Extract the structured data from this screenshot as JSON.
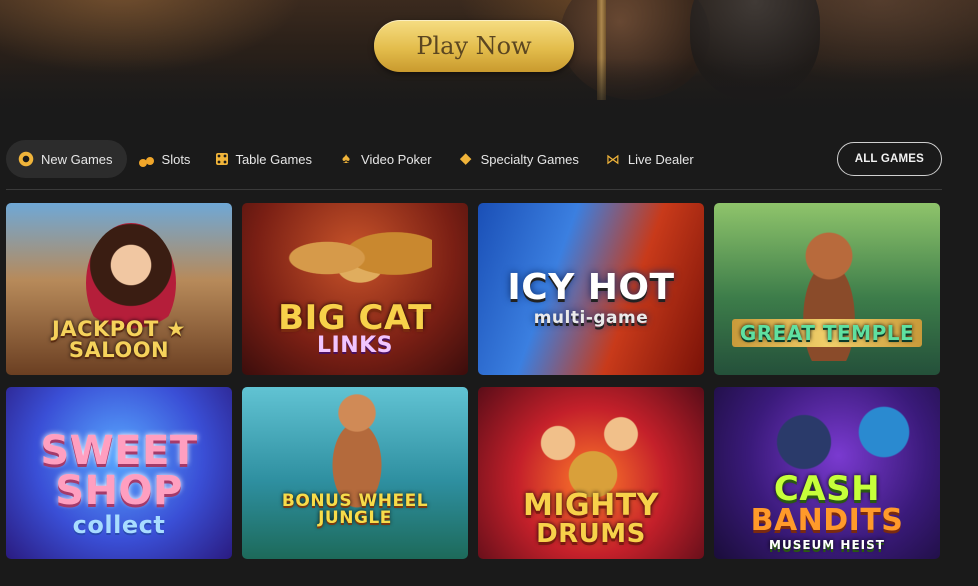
{
  "hero": {
    "play_button_label": "Play Now"
  },
  "tabs": [
    {
      "label": "New Games",
      "icon": "donut-icon",
      "active": true
    },
    {
      "label": "Slots",
      "icon": "cherry-icon",
      "active": false
    },
    {
      "label": "Table Games",
      "icon": "dice-icon",
      "active": false
    },
    {
      "label": "Video Poker",
      "icon": "spade-icon",
      "active": false
    },
    {
      "label": "Specialty Games",
      "icon": "diamond-icon",
      "active": false
    },
    {
      "label": "Live Dealer",
      "icon": "bowtie-icon",
      "active": false
    }
  ],
  "all_games_label": "ALL GAMES",
  "games": [
    {
      "line1": "JACKPOT ★ SALOON",
      "line2": "",
      "line3": ""
    },
    {
      "line1": "BIG CAT",
      "line2": "LINKS",
      "line3": ""
    },
    {
      "line1": "ICY HOT",
      "line2": "multi-game",
      "line3": ""
    },
    {
      "line1": "GREAT TEMPLE",
      "line2": "",
      "line3": ""
    },
    {
      "line1": "SWEET SHOP",
      "line2": "collect",
      "line3": ""
    },
    {
      "line1": "BONUS WHEEL JUNGLE",
      "line2": "",
      "line3": ""
    },
    {
      "line1": "MIGHTY",
      "line2": "DRUMS",
      "line3": ""
    },
    {
      "line1": "CASH",
      "line2": "BANDITS",
      "line3": "MUSEUM HEIST"
    }
  ],
  "colors": {
    "accent_gold": "#e3bd4c",
    "background": "#1a1a1a",
    "active_tab_bg": "#2c2c2c"
  }
}
